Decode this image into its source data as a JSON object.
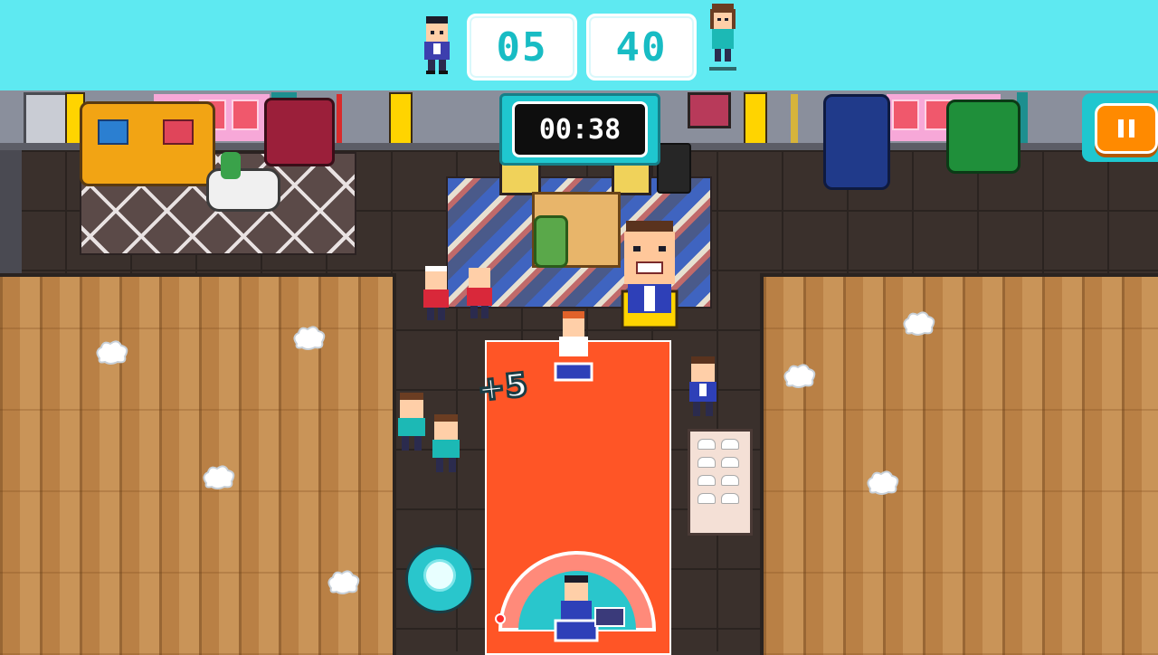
{
  "hud": {
    "score_left": "05",
    "score_right": "40",
    "timer": "00:38",
    "pause_icon": "pause-icon"
  },
  "popup": {
    "points_text": "+5"
  },
  "colors": {
    "hud_bar": "#5ee9f1",
    "score_text": "#18bcc4",
    "court": "#ff5526",
    "pause_button": "#ff8a00",
    "arc_active": "#29c6cc"
  },
  "icons": [
    "player-avatar-left-icon",
    "player-avatar-right-icon",
    "pause-icon",
    "cloud-icon",
    "robot-vacuum-icon"
  ]
}
